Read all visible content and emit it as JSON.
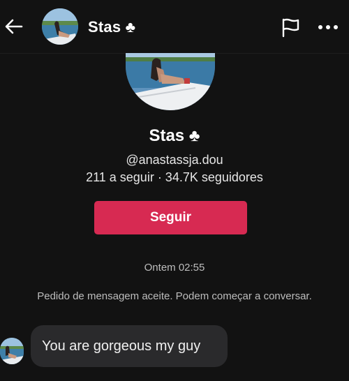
{
  "header": {
    "name": "Stas ♣",
    "back_icon": "arrow-left-icon",
    "report_icon": "flag-icon",
    "more_icon": "more-horizontal-icon"
  },
  "profile": {
    "name": "Stas ♣",
    "username": "@anastassja.dou",
    "stats": "211 a seguir · 34.7K seguidores",
    "follow_label": "Seguir"
  },
  "chat": {
    "timestamp": "Ontem 02:55",
    "system_message": "Pedido de mensagem aceite. Podem começar a conversar.",
    "messages": [
      {
        "text": "You are gorgeous my guy"
      }
    ]
  },
  "colors": {
    "background": "#121212",
    "accent": "#d72a52",
    "bubble": "#2a2a2c"
  }
}
